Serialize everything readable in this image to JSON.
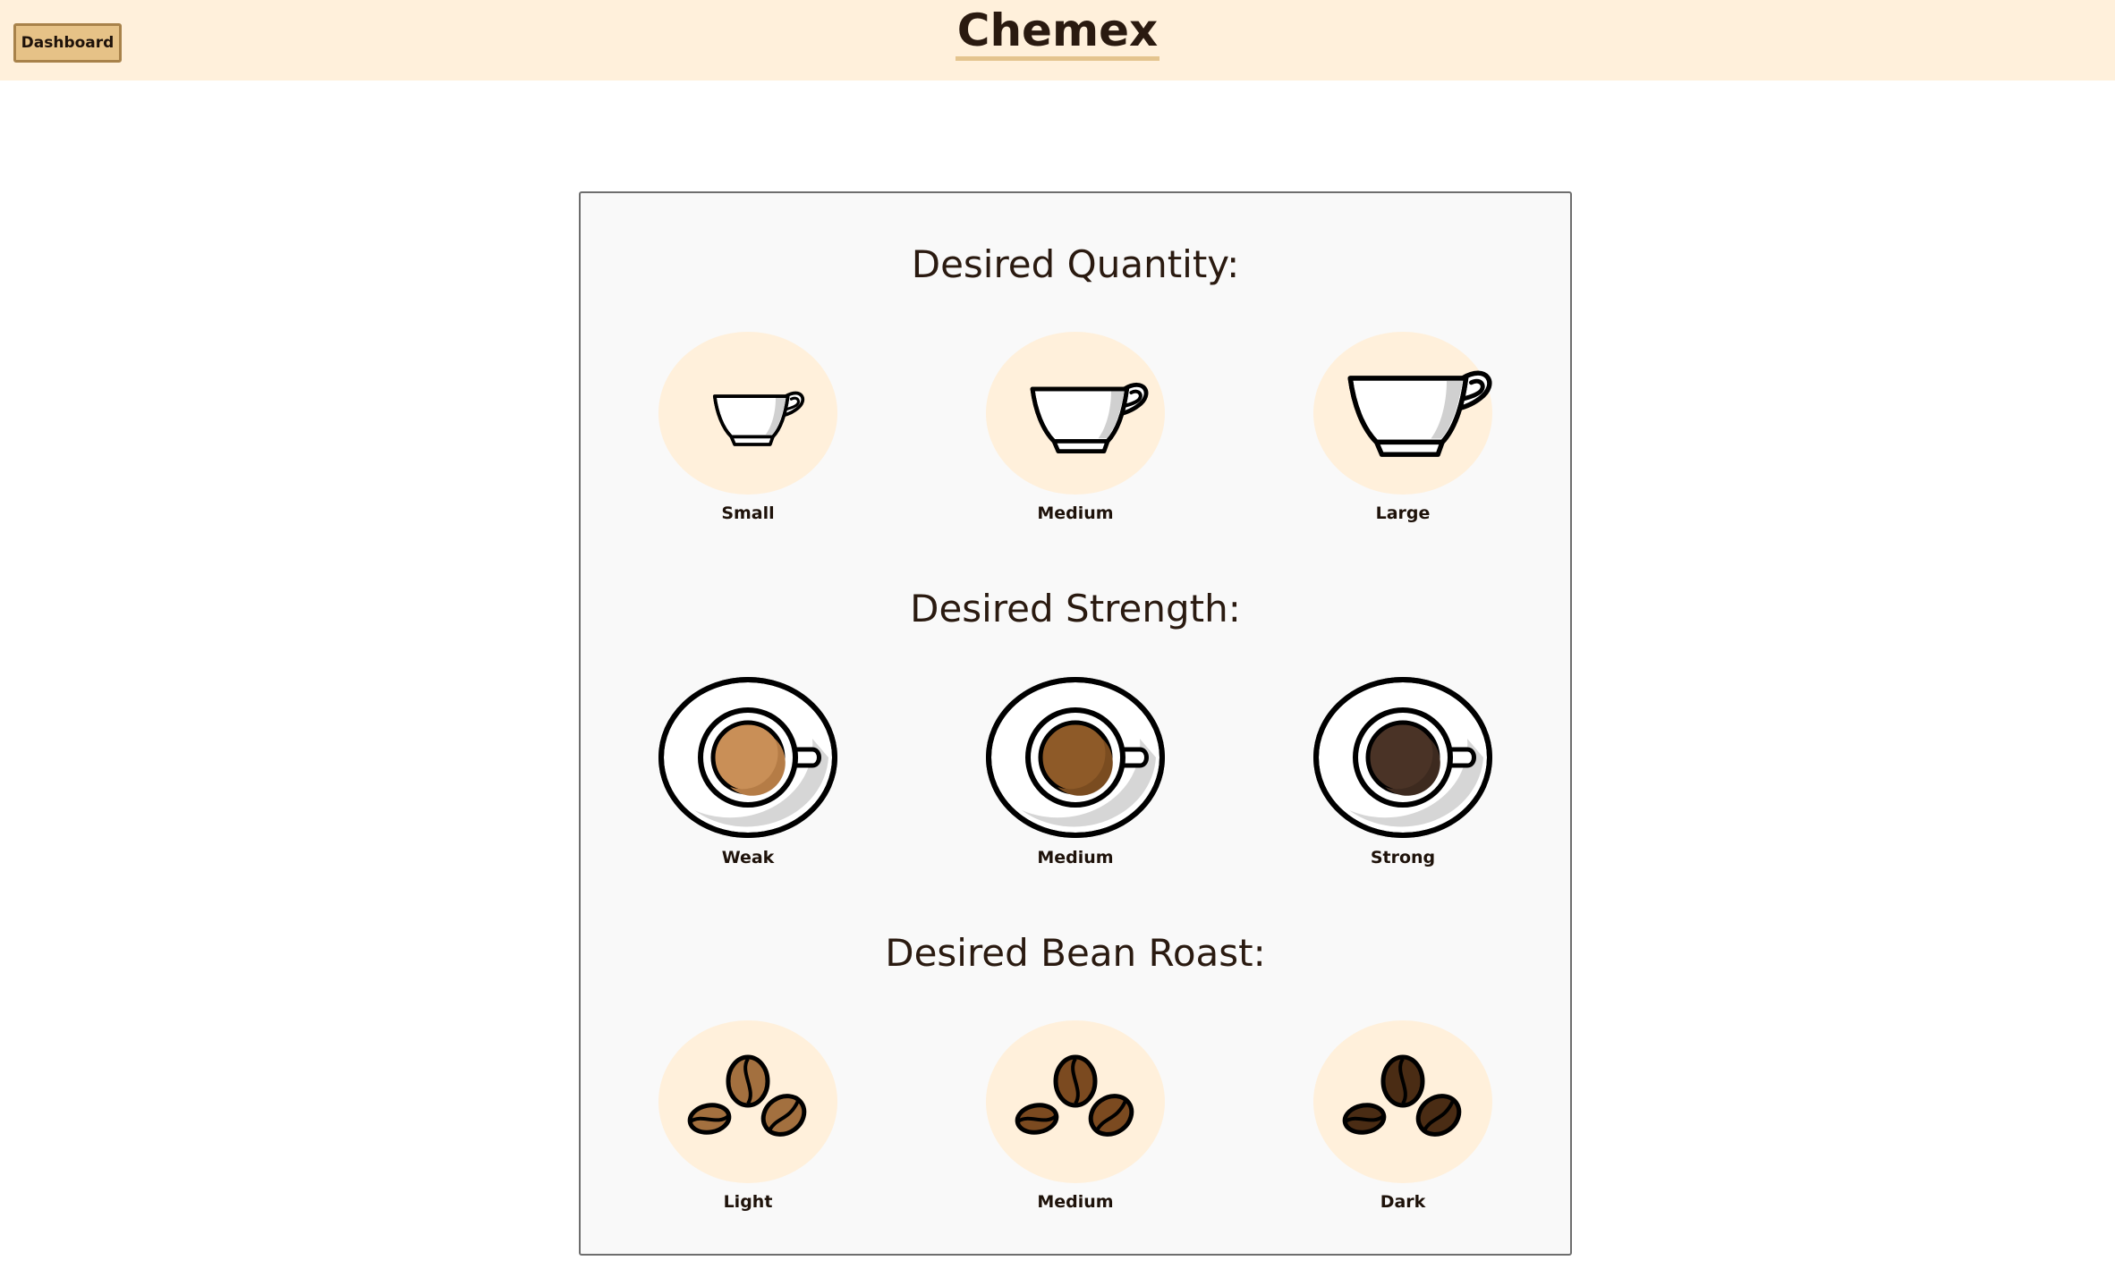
{
  "header": {
    "dashboard_label": "Dashboard",
    "title": "Chemex"
  },
  "quantity": {
    "title": "Desired Quantity:",
    "options": [
      {
        "label": "Small",
        "icon": "small-cup-icon"
      },
      {
        "label": "Medium",
        "icon": "medium-cup-icon"
      },
      {
        "label": "Large",
        "icon": "large-cup-icon"
      }
    ]
  },
  "strength": {
    "title": "Desired Strength:",
    "options": [
      {
        "label": "Weak",
        "icon": "weak-coffee-cup-icon",
        "color": "#c98f57"
      },
      {
        "label": "Medium",
        "icon": "medium-coffee-cup-icon",
        "color": "#8e5a28"
      },
      {
        "label": "Strong",
        "icon": "strong-coffee-cup-icon",
        "color": "#4a3326"
      }
    ]
  },
  "roast": {
    "title": "Desired Bean Roast:",
    "options": [
      {
        "label": "Light",
        "icon": "light-beans-icon",
        "color": "#a3703f"
      },
      {
        "label": "Medium",
        "icon": "medium-beans-icon",
        "color": "#7b4a20"
      },
      {
        "label": "Dark",
        "icon": "dark-beans-icon",
        "color": "#4a2c14"
      }
    ]
  },
  "colors": {
    "header_bg": "#fff0db",
    "button_bg": "#e6c287",
    "panel_bg": "#f9f9f9",
    "option_bg": "#fff0db"
  }
}
